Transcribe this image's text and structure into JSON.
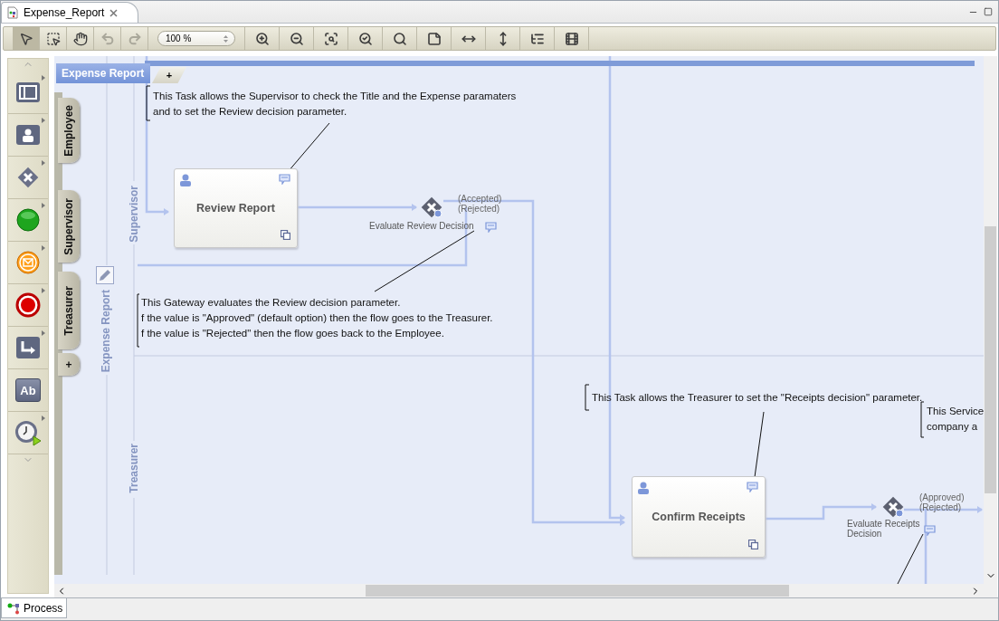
{
  "editor_tab": {
    "title": "Expense_Report",
    "selected": true
  },
  "tools": [
    {
      "kind": "select",
      "selected": true
    },
    {
      "kind": "marquee",
      "selected": false
    },
    {
      "kind": "pan",
      "selected": false
    }
  ],
  "history": [
    {
      "kind": "undo",
      "disabled": true
    },
    {
      "kind": "redo",
      "disabled": true
    }
  ],
  "zoom_field": {
    "value": "100 %"
  },
  "actions": [
    {
      "kind": "zoom-in"
    },
    {
      "kind": "zoom-out"
    },
    {
      "kind": "zoom-region"
    },
    {
      "kind": "zoom-page"
    },
    {
      "kind": "zoom-search"
    },
    {
      "kind": "note"
    },
    {
      "kind": "spread-horizontal"
    },
    {
      "kind": "spread-vertical"
    },
    {
      "kind": "list"
    },
    {
      "kind": "film"
    }
  ],
  "palette": [
    {
      "kind": "lane",
      "submenu": true
    },
    {
      "kind": "task",
      "submenu": true
    },
    {
      "kind": "gateway",
      "submenu": true
    },
    {
      "kind": "start",
      "submenu": true
    },
    {
      "kind": "message",
      "submenu": true
    },
    {
      "kind": "end",
      "submenu": true
    },
    {
      "kind": "subprocess",
      "submenu": true
    },
    {
      "kind": "text",
      "submenu": false,
      "label": "Ab"
    },
    {
      "kind": "timer",
      "submenu": true
    }
  ],
  "pool": {
    "title": "Expense Report",
    "add_tab": "+",
    "label": "Expense Report"
  },
  "lane_tabs": [
    {
      "label": "Employee"
    },
    {
      "label": "Supervisor"
    },
    {
      "label": "Treasurer"
    }
  ],
  "lane_add": "+",
  "lanes": [
    {
      "label": "Supervisor"
    },
    {
      "label": "Treasurer"
    }
  ],
  "annotations": [
    {
      "text": "This Task allows the Supervisor to check the Title and the Expense paramaters\nand to set the Review decision parameter."
    },
    {
      "text": "This Gateway evaluates the Review decision parameter.\nf the value is \"Approved\" (default option) then the flow goes to the Treasurer.\nf the value is \"Rejected\" then the flow goes back to the Employee."
    },
    {
      "text": "This Task allows the Treasurer to set the \"Receipts decision\" parameter."
    },
    {
      "text": "This Service\ncompany a"
    }
  ],
  "tasks": [
    {
      "name": "Review Report"
    },
    {
      "name": "Confirm Receipts"
    }
  ],
  "gateways": [
    {
      "label": "Evaluate Review Decision",
      "flows": [
        "(Accepted)",
        "(Rejected)"
      ]
    },
    {
      "label": "Evaluate Receipts Decision",
      "flows": [
        "(Approved)",
        "(Rejected)"
      ]
    }
  ],
  "bottom_tab": {
    "label": "Process",
    "selected": true
  }
}
